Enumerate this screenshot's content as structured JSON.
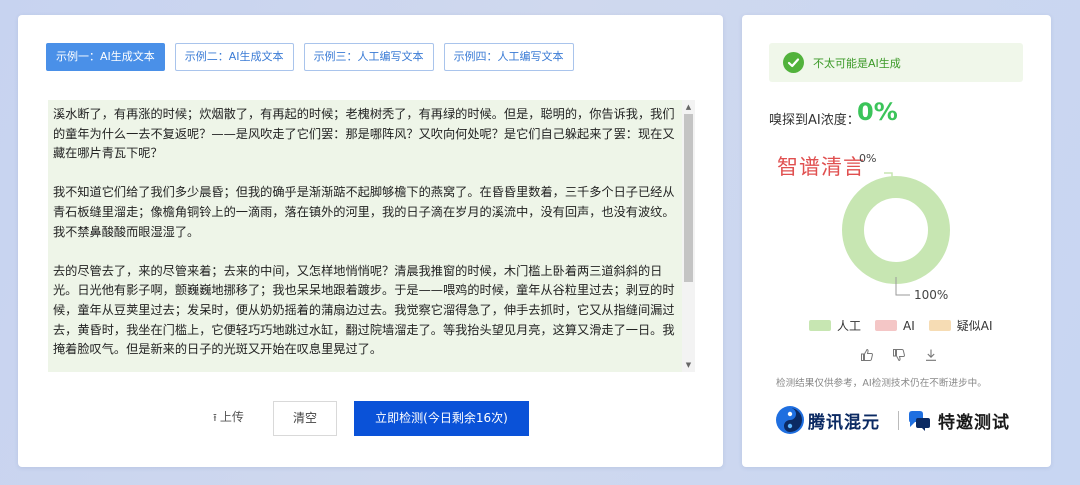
{
  "tabs": [
    {
      "label": "示例一：AI生成文本",
      "active": true
    },
    {
      "label": "示例二：AI生成文本",
      "active": false
    },
    {
      "label": "示例三：人工编写文本",
      "active": false
    },
    {
      "label": "示例四：人工编写文本",
      "active": false
    }
  ],
  "editor": {
    "paragraphs": [
      "溪水断了，有再涨的时候；炊烟散了，有再起的时候；老槐树秃了，有再绿的时候。但是，聪明的，你告诉我，我们的童年为什么一去不复返呢？——是风吹走了它们罢：那是哪阵风？又吹向何处呢？是它们自己躲起来了罢：现在又藏在哪片青瓦下呢？",
      "我不知道它们给了我们多少晨昏；但我的确乎是渐渐踮不起脚够檐下的燕窝了。在昏昏里数着，三千多个日子已经从青石板缝里溜走；像檐角铜铃上的一滴雨，落在镇外的河里，我的日子滴在岁月的溪流中，没有回声，也没有波纹。我不禁鼻酸酸而眼湿湿了。",
      "去的尽管去了，来的尽管来着；去来的中间，又怎样地悄悄呢？清晨我推窗的时候，木门槛上卧着两三道斜斜的日光。日光他有影子啊，颤巍巍地挪移了；我也呆呆地跟着踱步。于是——喂鸡的时候，童年从谷粒里过去；剥豆的时候，童年从豆荚里过去；发呆时，便从奶奶摇着的蒲扇边过去。我觉察它溜得急了，伸手去抓时，它又从指缝间漏过去，黄昏时，我坐在门槛上，它便轻巧巧地跳过水缸，翻过院墙溜走了。等我抬头望见月亮，这算又滑走了一日。我掩着脸叹气。但是新来的日子的光斑又开始在叹息里晃过了。"
    ]
  },
  "actions": {
    "upload_label": "上传",
    "upload_icon": "upload-arrow-icon",
    "clear_label": "清空",
    "detect_label": "立即检测(今日剩余16次)"
  },
  "result": {
    "verdict": "不太可能是AI生成",
    "concentration_label": "嗅探到AI浓度：",
    "concentration_value": "0%",
    "watermark": "智谱清言",
    "donut_top_label": "0%",
    "donut_bottom_label": "100%",
    "donut": {
      "segments": [
        {
          "name": "人工",
          "value": 100,
          "color": "#c7e6b2"
        },
        {
          "name": "AI",
          "value": 0,
          "color": "#f4c6c6"
        },
        {
          "name": "疑似AI",
          "value": 0,
          "color": "#f6dcb4"
        }
      ]
    },
    "legend": [
      {
        "label": "人工",
        "color": "#c7e6b2"
      },
      {
        "label": "AI",
        "color": "#f4c6c6"
      },
      {
        "label": "疑似AI",
        "color": "#f6dcb4"
      }
    ],
    "feedback_icons": [
      "thumbs-up-icon",
      "thumbs-down-icon",
      "download-icon"
    ],
    "disclaimer": "检测结果仅供参考，AI检测技术仍在不断进步中。",
    "brand_primary": "腾讯混元",
    "brand_secondary": "特邀测试",
    "colors": {
      "accent": "#0a52d8",
      "tab_active": "#4a90e8",
      "success": "#52b23c",
      "concentration": "#3bc45a"
    }
  }
}
